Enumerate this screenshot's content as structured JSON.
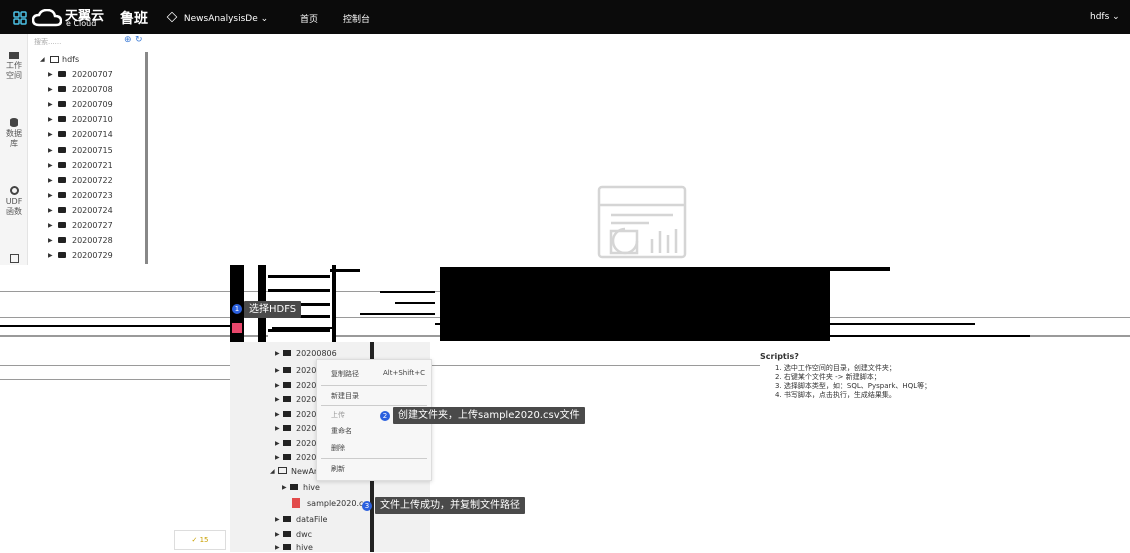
{
  "topbar": {
    "brand_cn": "天翼云",
    "brand_en": "e Cloud",
    "product": "鲁班",
    "project": "NewsAnalysisDe",
    "nav": [
      "首页",
      "控制台"
    ],
    "user": "hdfs"
  },
  "leftbar": {
    "items": [
      "工作空间",
      "数据库",
      "UDF函数"
    ]
  },
  "tree": {
    "search_placeholder": "搜索......",
    "root": "hdfs",
    "folders": [
      "20200707",
      "20200708",
      "20200709",
      "20200710",
      "20200714",
      "20200715",
      "20200721",
      "20200722",
      "20200723",
      "20200724",
      "20200727",
      "20200728",
      "20200729"
    ]
  },
  "overlay": {
    "step1": "选择HDFS",
    "step2": "创建文件夹，上传sample2020.csv文件",
    "step3": "文件上传成功，并复制文件路径",
    "badges": [
      "1",
      "2",
      "3"
    ],
    "folder_first": "20200806",
    "folder_prefix": "202008",
    "newfolder": "NewAn",
    "hive_sub": "hive",
    "csv_file": "sample2020.csv",
    "lower_folders": [
      "dataFile",
      "dwc",
      "hive"
    ],
    "counter": "15",
    "ctx_menu": {
      "copy_path": "复制路径",
      "shortcut": "Alt+Shift+C",
      "new_dir": "新建目录",
      "upload": "上传",
      "rename": "重命名",
      "delete": "删除",
      "refresh": "刷新"
    },
    "help": {
      "title": "Scriptis?",
      "lines": [
        "1. 选中工作空间的目录，创建文件夹；",
        "2. 右键某个文件夹 -> 新建脚本；",
        "3. 选择脚本类型，如：SQL、Pyspark、HQL等；",
        "4. 书写脚本，点击执行，生成结果集。"
      ]
    }
  }
}
